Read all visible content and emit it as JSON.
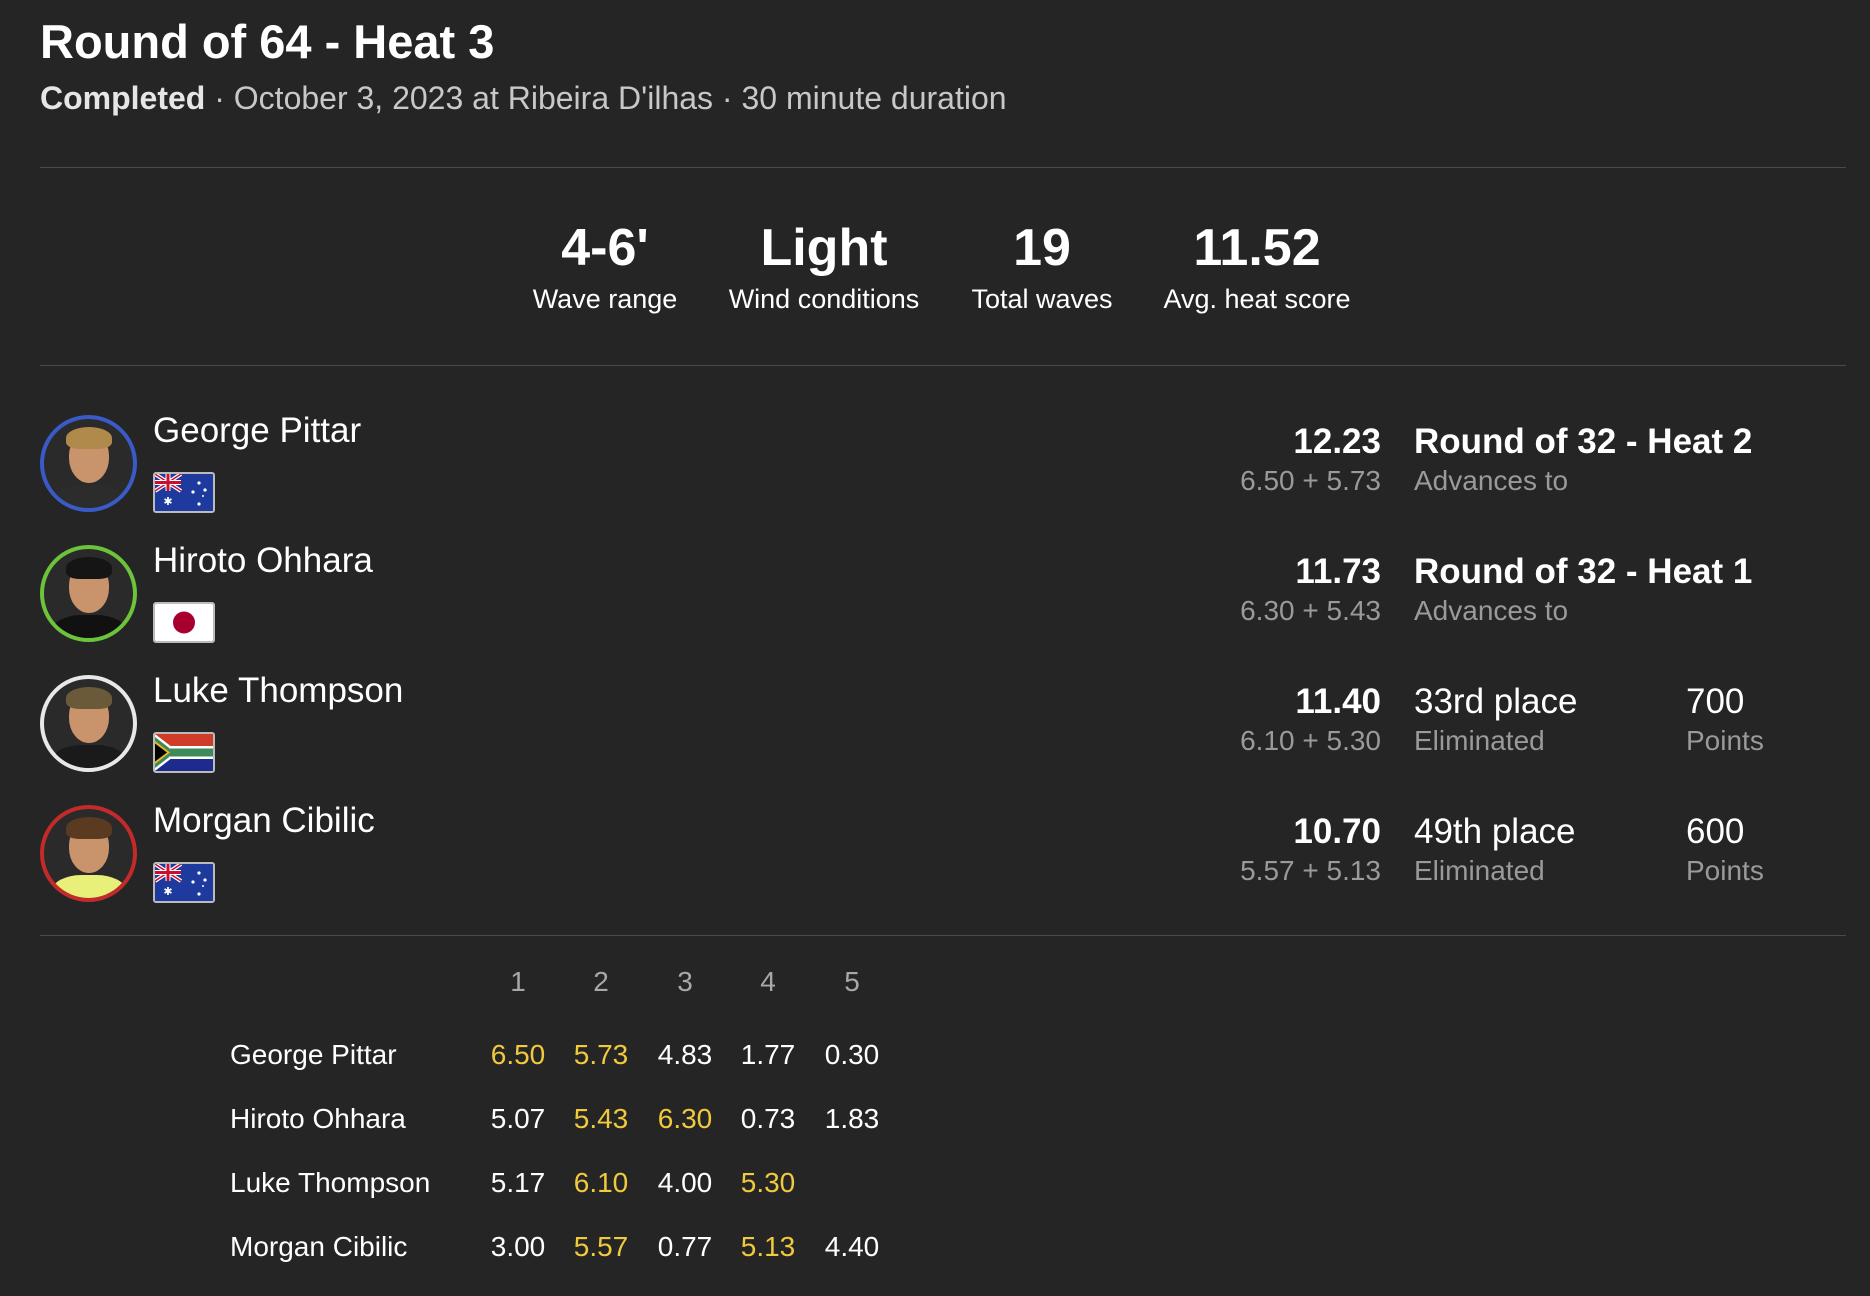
{
  "header": {
    "title": "Round of 64 - Heat 3",
    "status": "Completed",
    "details": " · October 3, 2023 at Ribeira D'ilhas · 30 minute duration"
  },
  "stats": [
    {
      "value": "4-6'",
      "label": "Wave range"
    },
    {
      "value": "Light",
      "label": "Wind conditions"
    },
    {
      "value": "19",
      "label": "Total waves"
    },
    {
      "value": "11.52",
      "label": "Avg. heat score"
    }
  ],
  "athletes": [
    {
      "name": "George Pittar",
      "country": "Australia",
      "flag_icon": "australia-flag-icon",
      "ring_color": "#3a5bc7",
      "total": "12.23",
      "breakdown": "6.50 + 5.73",
      "result": "Round of 32 - Heat 2",
      "result_label": "Advances to",
      "points": "",
      "points_label": ""
    },
    {
      "name": "Hiroto Ohhara",
      "country": "Japan",
      "flag_icon": "japan-flag-icon",
      "ring_color": "#6cc43a",
      "total": "11.73",
      "breakdown": "6.30 + 5.43",
      "result": "Round of 32 - Heat 1",
      "result_label": "Advances to",
      "points": "",
      "points_label": ""
    },
    {
      "name": "Luke Thompson",
      "country": "South Africa",
      "flag_icon": "south-africa-flag-icon",
      "ring_color": "#e8e8e8",
      "total": "11.40",
      "breakdown": "6.10 + 5.30",
      "result": "33rd place",
      "result_label": "Eliminated",
      "points": "700",
      "points_label": "Points"
    },
    {
      "name": "Morgan Cibilic",
      "country": "Australia",
      "flag_icon": "australia-flag-icon",
      "ring_color": "#c42a2a",
      "total": "10.70",
      "breakdown": "5.57 + 5.13",
      "result": "49th place",
      "result_label": "Eliminated",
      "points": "600",
      "points_label": "Points"
    }
  ],
  "wave_table": {
    "columns": [
      "1",
      "2",
      "3",
      "4",
      "5"
    ],
    "highlight_color": "#f0c93c",
    "rows": [
      {
        "name": "George Pittar",
        "scores": [
          "6.50",
          "5.73",
          "4.83",
          "1.77",
          "0.30"
        ],
        "counting": [
          0,
          1
        ]
      },
      {
        "name": "Hiroto Ohhara",
        "scores": [
          "5.07",
          "5.43",
          "6.30",
          "0.73",
          "1.83"
        ],
        "counting": [
          1,
          2
        ]
      },
      {
        "name": "Luke Thompson",
        "scores": [
          "5.17",
          "6.10",
          "4.00",
          "5.30",
          ""
        ],
        "counting": [
          1,
          3
        ]
      },
      {
        "name": "Morgan Cibilic",
        "scores": [
          "3.00",
          "5.57",
          "0.77",
          "5.13",
          "4.40"
        ],
        "counting": [
          1,
          3
        ]
      }
    ]
  }
}
